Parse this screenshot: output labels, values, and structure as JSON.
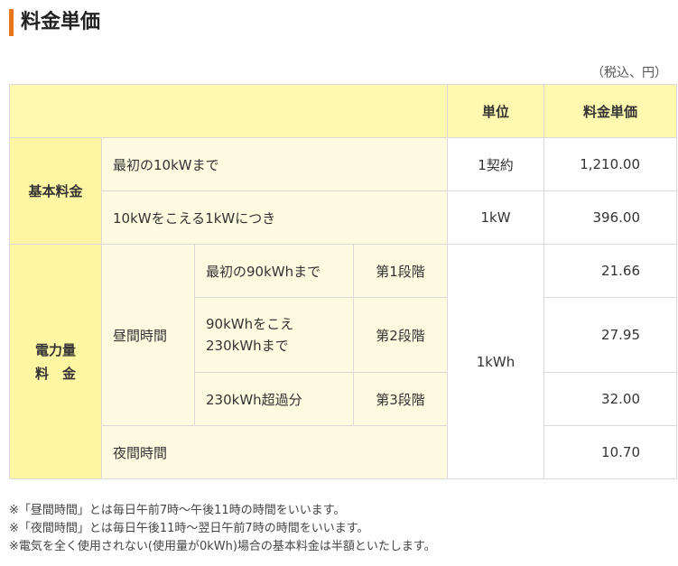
{
  "title": "料金単価",
  "unit_note": "（税込、円）",
  "table": {
    "header": {
      "unit": "単位",
      "price": "料金単価"
    },
    "basic": {
      "category": "基本料金",
      "rows": [
        {
          "desc": "最初の10kWまで",
          "unit": "1契約",
          "price": "1,210.00"
        },
        {
          "desc": "10kWをこえる1kWにつき",
          "unit": "1kW",
          "price": "396.00"
        }
      ]
    },
    "energy": {
      "category_line1": "電力量",
      "category_line2": "料　金",
      "unit": "1kWh",
      "daytime": {
        "label": "昼間時間",
        "tiers": [
          {
            "desc": "最初の90kWhまで",
            "stage": "第1段階",
            "price": "21.66"
          },
          {
            "desc_line1": "90kWhをこえ",
            "desc_line2": "230kWhまで",
            "stage": "第2段階",
            "price": "27.95"
          },
          {
            "desc": "230kWh超過分",
            "stage": "第3段階",
            "price": "32.00"
          }
        ]
      },
      "night": {
        "label": "夜間時間",
        "price": "10.70"
      }
    }
  },
  "notes": [
    "※「昼間時間」とは毎日午前7時～午後11時の時間をいいます。",
    "※「夜間時間」とは毎日午後11時～翌日午前7時の時間をいいます。",
    "※電気を全く使用されない(使用量が0kWh)場合の基本料金は半額といたします。"
  ]
}
